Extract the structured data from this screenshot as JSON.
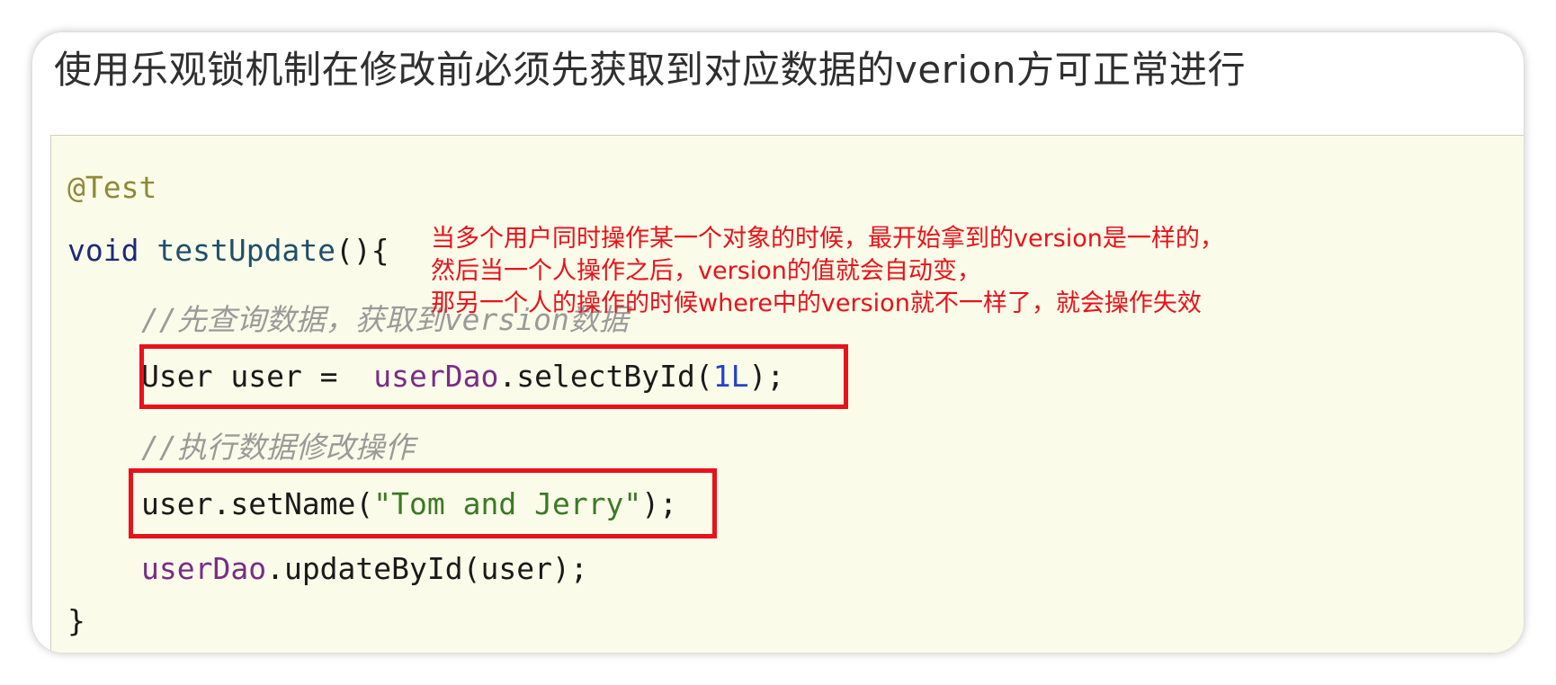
{
  "heading": "使用乐观锁机制在修改前必须先获取到对应数据的verion方可正常进行",
  "notes": [
    "当多个用户同时操作某一个对象的时候，最开始拿到的version是一样的，",
    "然后当一个人操作之后，version的值就会自动变，",
    "那另一个人的操作的时候where中的version就不一样了，就会操作失效"
  ],
  "code": {
    "annotation": "@Test",
    "sig_kw": "void",
    "sig_name": "testUpdate",
    "sig_rest": "(){",
    "comment1": "//先查询数据，获取到version数据",
    "stmt1_a": "User user =  ",
    "stmt1_field": "userDao",
    "stmt1_b": ".selectById(",
    "stmt1_num": "1L",
    "stmt1_c": ");",
    "comment2": "//执行数据修改操作",
    "stmt2_a": "user.setName(",
    "stmt2_str": "\"Tom and Jerry\"",
    "stmt2_b": ");",
    "stmt3_field": "userDao",
    "stmt3_b": ".updateById(user);",
    "close": "}"
  },
  "colors": {
    "highlight": "#e8121a",
    "panel_bg": "#fbfbe9"
  },
  "icons": [
    "mouse-cursor-icon"
  ]
}
